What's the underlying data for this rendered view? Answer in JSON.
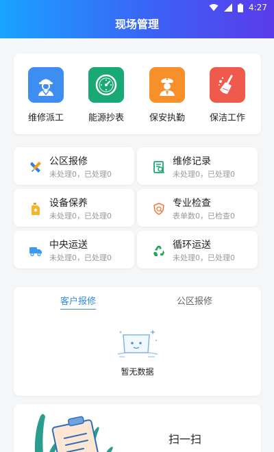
{
  "status": {
    "time": "4:27"
  },
  "header": {
    "title": "现场管理"
  },
  "quick_actions": [
    {
      "label": "维修派工",
      "icon": "repair-worker-icon",
      "color": "#3d8ef0"
    },
    {
      "label": "能源抄表",
      "icon": "meter-icon",
      "color": "#19a974"
    },
    {
      "label": "保安执勤",
      "icon": "security-guard-icon",
      "color": "#f7902b"
    },
    {
      "label": "保洁工作",
      "icon": "broom-icon",
      "color": "#ef5a4c"
    }
  ],
  "stats": [
    {
      "title": "公区报修",
      "sub": "未处理0，已处理0",
      "icon": "wrench-screwdriver-icon"
    },
    {
      "title": "维修记录",
      "sub": "未处理0，已处理0",
      "icon": "record-book-icon"
    },
    {
      "title": "设备保养",
      "sub": "未处理0，已处理0",
      "icon": "oil-bottle-icon"
    },
    {
      "title": "专业检查",
      "sub": "表单数0，已检查0",
      "icon": "shield-check-icon"
    },
    {
      "title": "中央运送",
      "sub": "未处理0，已处理0",
      "icon": "truck-icon"
    },
    {
      "title": "循环运送",
      "sub": "未处理0，已处理0",
      "icon": "recycle-icon"
    }
  ],
  "tabs": {
    "active": "客户报修",
    "inactive": "公区报修"
  },
  "empty": {
    "text": "暂无数据"
  },
  "scan": {
    "label": "扫一扫"
  }
}
